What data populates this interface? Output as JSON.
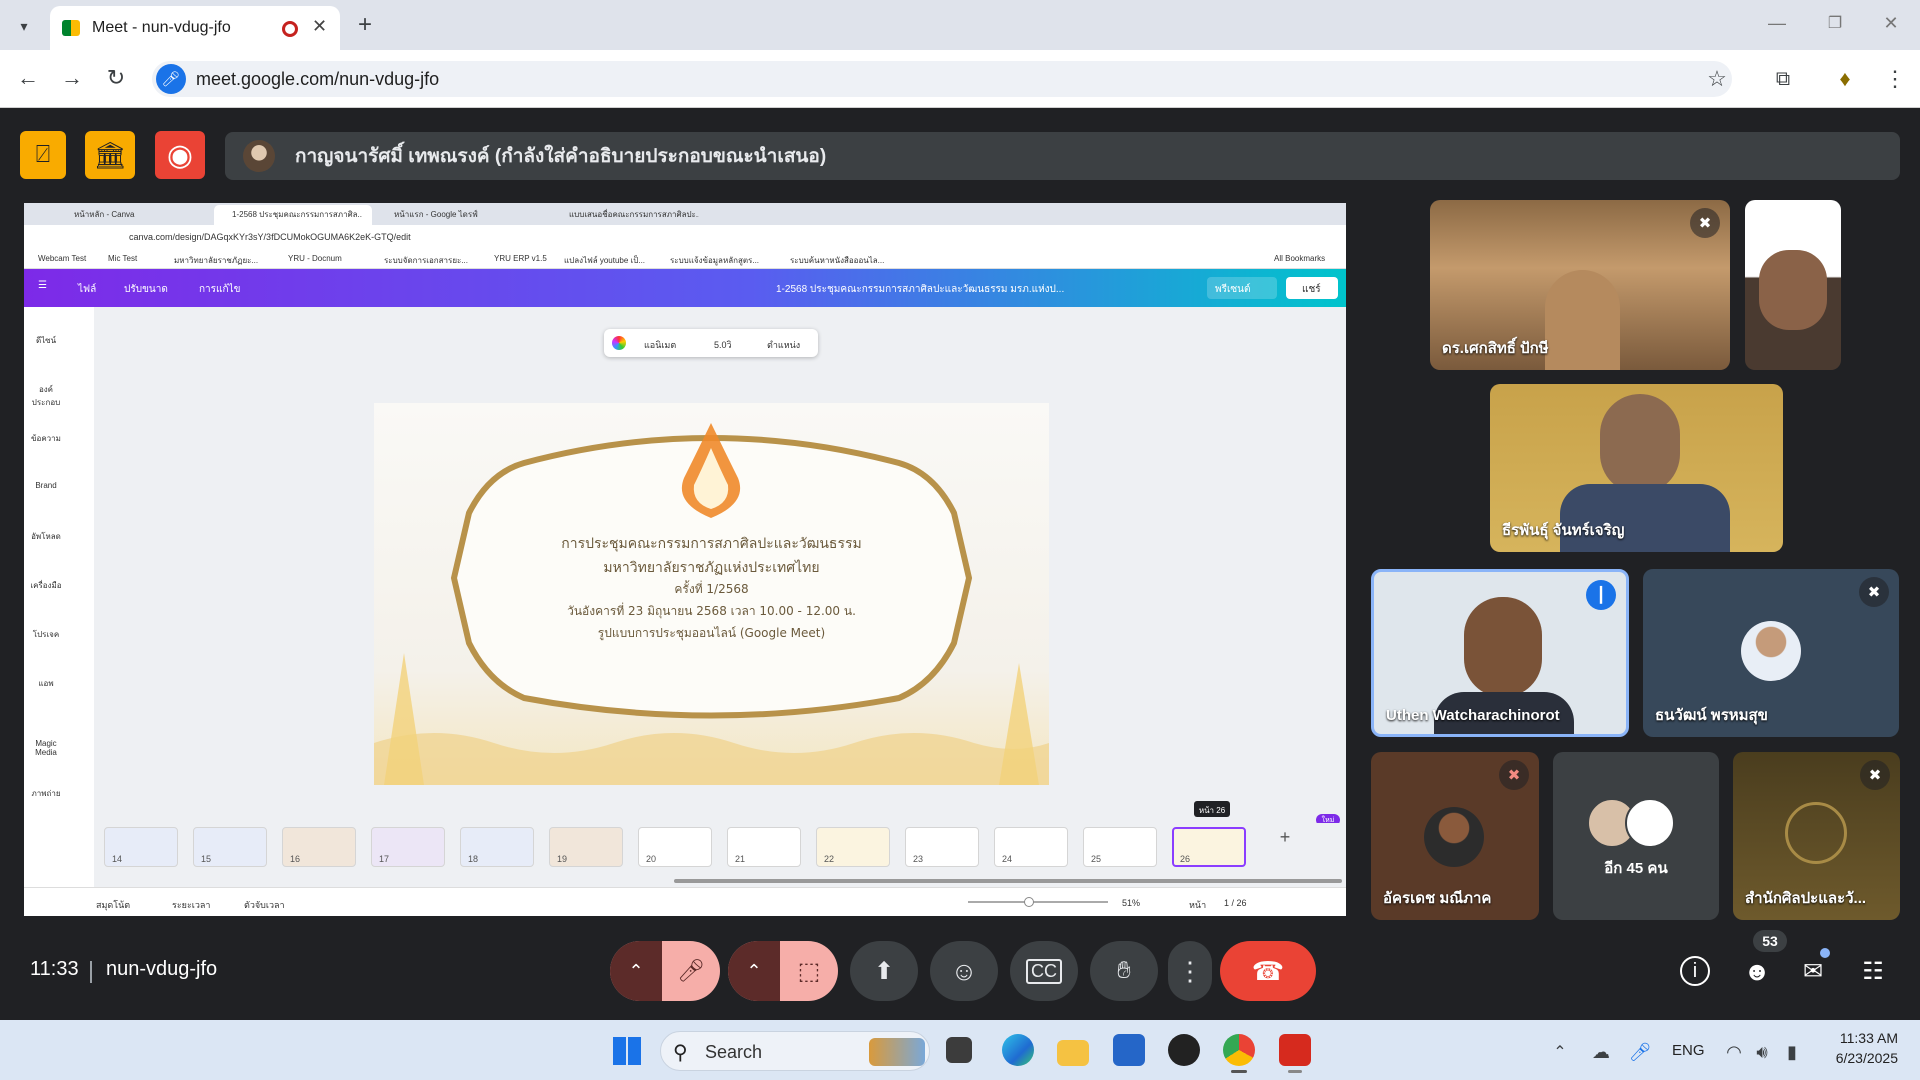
{
  "browser": {
    "tab_title": "Meet - nun-vdug-jfo",
    "url": "meet.google.com/nun-vdug-jfo"
  },
  "banner": {
    "presenter_text": "กาญจนารัศมิ์ เทพณรงค์ (กำลังใส่คำอธิบายประกอบขณะนำเสนอ)"
  },
  "shared_screen": {
    "tabs": [
      "หน้าหลัก - Canva",
      "1-2568 ประชุมคณะกรรมการสภาศิล...",
      "หน้าแรก - Google ไดรฟ์",
      "แบบเสนอชื่อคณะกรรมการสภาศิลปะ..."
    ],
    "url": "canva.com/design/DAGqxKYr3sY/3fDCUMokOGUMA6K2eK-GTQ/edit",
    "bookmarks": [
      "Webcam Test",
      "Mic Test",
      "มหาวิทยาลัยราชภัฏยะ...",
      "YRU - Docnum",
      "ระบบจัดการเอกสารยะ...",
      "YRU ERP v1.5",
      "แปลงไฟล์ youtube เป็...",
      "ระบบแจ้งข้อมูลหลักสูตร...",
      "ระบบค้นหาหนังสือออนไล..."
    ],
    "all_bookmarks": "All Bookmarks",
    "canva_menu": [
      "ไฟล์",
      "ปรับขนาด",
      "การแก้ไข"
    ],
    "doc_title": "1-2568 ประชุมคณะกรรมการสภาศิลปะและวัฒนธรรม มรภ.แห่งป...",
    "present_btn": "พรีเซนต์",
    "share_btn": "แชร์",
    "float_toolbar": [
      "แอนิเมต",
      "5.0วิ",
      "ตำแหน่ง"
    ],
    "sidebar": [
      "ดีไซน์",
      "องค์ประกอบ",
      "ข้อความ",
      "Brand",
      "อัพโหลด",
      "เครื่องมือ",
      "โปรเจค",
      "แอพ",
      "Magic Media",
      "ภาพถ่าย"
    ],
    "slide_lines": [
      "การประชุมคณะกรรมการสภาศิลปะและวัฒนธรรม",
      "มหาวิทยาลัยราชภัฏแห่งประเทศไทย",
      "ครั้งที่ 1/2568",
      "วันอังคารที่ 23 มิถุนายน 2568 เวลา 10.00 - 12.00 น.",
      "รูปแบบการประชุมออนไลน์ (Google Meet)"
    ],
    "thumb_numbers": [
      "14",
      "15",
      "16",
      "17",
      "18",
      "19",
      "20",
      "21",
      "22",
      "23",
      "24",
      "25",
      "26"
    ],
    "page_tooltip": "หน้า 26",
    "new_badge": "ใหม่",
    "status_left": [
      "สมุดโน้ต",
      "ระยะเวลา",
      "ตัวจับเวลา"
    ],
    "zoom": "51%",
    "pages_label": "หน้า",
    "page_count": "1 / 26"
  },
  "participants": [
    {
      "name": "ดร.เศกสิทธิ์ ปักษี",
      "muted": true
    },
    {
      "name": "",
      "muted": false
    },
    {
      "name": "ธีรพันธุ์ จันทร์เจริญ",
      "muted": false
    },
    {
      "name": "Uthen Watcharachinorot",
      "speaking": true
    },
    {
      "name": "ธนวัฒน์ พรหมสุข",
      "muted": true
    },
    {
      "name": "อัครเดช มณีภาค",
      "muted": true
    },
    {
      "name": "อีก 45 คน"
    },
    {
      "name": "สำนักศิลปะและวั...",
      "muted": true
    }
  ],
  "meeting": {
    "time": "11:33",
    "code": "nun-vdug-jfo",
    "people_count": "53"
  },
  "taskbar": {
    "search": "Search",
    "lang": "ENG",
    "time": "11:33 AM",
    "date": "6/23/2025"
  },
  "colors": {
    "accent_yellow": "#f9ab00",
    "record_red": "#ea4335",
    "end_call": "#ea4335",
    "canva_gradient_start": "#7d2ae8",
    "canva_gradient_end": "#00c4cc"
  }
}
